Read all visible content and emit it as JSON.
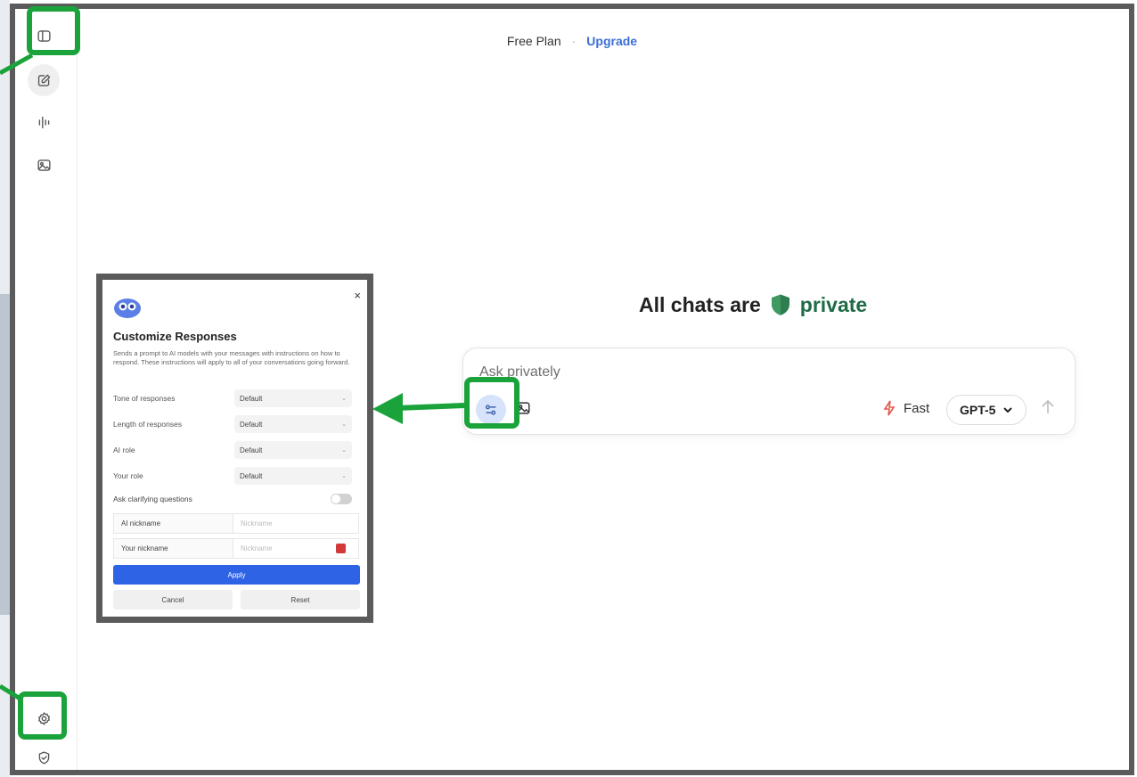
{
  "header": {
    "plan": "Free Plan",
    "separator": "·",
    "upgrade": "Upgrade"
  },
  "hero": {
    "prefix": "All chats are",
    "highlight": "private"
  },
  "composer": {
    "placeholder": "Ask privately",
    "speed_label": "Fast",
    "model_label": "GPT-5"
  },
  "sidebar": {
    "icons": [
      "sidebar-toggle-icon",
      "new-chat-icon",
      "voice-icon",
      "image-icon",
      "settings-icon",
      "shield-check-icon"
    ]
  },
  "popup": {
    "close": "×",
    "title": "Customize Responses",
    "description": "Sends a prompt to AI models with your messages with instructions on how to respond. These instructions will apply to all of your conversations going forward.",
    "rows": [
      {
        "label": "Tone of responses",
        "value": "Default"
      },
      {
        "label": "Length of responses",
        "value": "Default"
      },
      {
        "label": "AI role",
        "value": "Default"
      },
      {
        "label": "Your role",
        "value": "Default"
      }
    ],
    "toggle_label": "Ask clarifying questions",
    "nicknames": [
      {
        "label": "AI nickname",
        "placeholder": "Nickname"
      },
      {
        "label": "Your nickname",
        "placeholder": "Nickname"
      }
    ],
    "apply": "Apply",
    "cancel": "Cancel",
    "reset": "Reset"
  },
  "colors": {
    "accent_green": "#1aa33b",
    "brand_blue": "#2f63e6",
    "private_green": "#1f6b45"
  }
}
